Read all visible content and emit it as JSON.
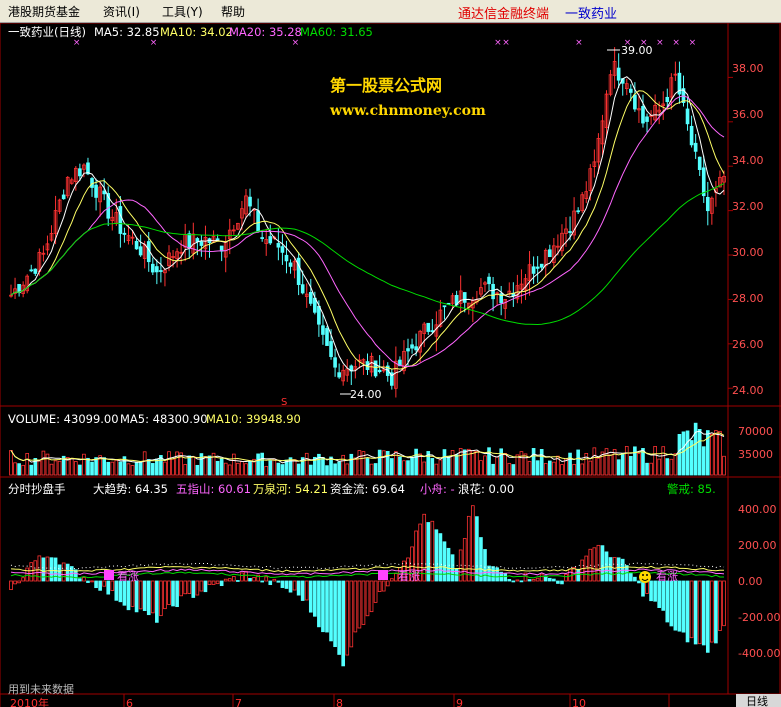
{
  "menu": {
    "items": [
      "港股期货基金",
      "资讯(I)",
      "工具(Y)",
      "帮助"
    ],
    "brand": "通达信金融终端",
    "stock_name": "一致药业"
  },
  "colors": {
    "background": "#000000",
    "frame": "#a00000",
    "up": "#ff3232",
    "down": "#54ffff",
    "ma5": "#ffffff",
    "ma10": "#ffff66",
    "ma20": "#ff66ff",
    "ma60": "#00dd00"
  },
  "watermark": {
    "line1": "第一股票公式网",
    "line2": "www.chnmoney.com"
  },
  "price_panel": {
    "title": "一致药业(日线)",
    "ma_labels": [
      "MA5: 32.85",
      "MA10: 34.02",
      "MA20: 35.28",
      "MA60: 31.65"
    ],
    "high_label": "39.00",
    "low_label": "24.00",
    "s_marker": "S",
    "axis_ticks": [
      "38.00",
      "36.00",
      "34.00",
      "32.00",
      "30.00",
      "28.00",
      "26.00",
      "24.00"
    ]
  },
  "volume_panel": {
    "labels": [
      "VOLUME: 43099.00",
      "MA5: 48300.90",
      "MA10: 39948.90"
    ],
    "axis_ticks": [
      "70000",
      "35000"
    ]
  },
  "indicator_panel": {
    "name": "分时抄盘手",
    "labels": [
      "大趋势: 64.35",
      "五指山: 60.61",
      "万泉河: 54.21",
      "资金流: 69.64",
      "小舟: -",
      "浪花: 0.00",
      "警戒: 85."
    ],
    "axis_ticks": [
      "400.00",
      "200.00",
      "0.00",
      "-200.00",
      "-400.00"
    ],
    "signals": [
      "看涨",
      "看涨",
      "看涨"
    ]
  },
  "bottom": {
    "note": "用到未来数据",
    "year": "2010年",
    "months": [
      "6",
      "7",
      "8",
      "9",
      "10"
    ],
    "period": "日线"
  },
  "chart_data": {
    "type": "candlestick",
    "title": "一致药业(日线)",
    "price_range": [
      23.2,
      40.0
    ],
    "annotated_high": 39.0,
    "annotated_low": 24.0,
    "price_anchors_close": [
      [
        0,
        28.2
      ],
      [
        8,
        30.0
      ],
      [
        14,
        33.5
      ],
      [
        18,
        34.0
      ],
      [
        24,
        32.0
      ],
      [
        28,
        31.0
      ],
      [
        32,
        30.3
      ],
      [
        36,
        29.2
      ],
      [
        42,
        30.5
      ],
      [
        48,
        30.7
      ],
      [
        52,
        30.5
      ],
      [
        58,
        32.5
      ],
      [
        62,
        30.8
      ],
      [
        66,
        30.4
      ],
      [
        70,
        29.5
      ],
      [
        76,
        26.5
      ],
      [
        80,
        24.9
      ],
      [
        86,
        25.1
      ],
      [
        90,
        25.0
      ],
      [
        94,
        24.5
      ],
      [
        98,
        25.6
      ],
      [
        104,
        27.0
      ],
      [
        110,
        28.0
      ],
      [
        116,
        28.5
      ],
      [
        122,
        28.2
      ],
      [
        128,
        29.3
      ],
      [
        134,
        30.5
      ],
      [
        140,
        32.0
      ],
      [
        144,
        34.0
      ],
      [
        148,
        38.5
      ],
      [
        152,
        38.0
      ],
      [
        156,
        36.0
      ],
      [
        160,
        36.5
      ],
      [
        164,
        38.0
      ],
      [
        168,
        35.0
      ],
      [
        172,
        32.0
      ],
      [
        176,
        33.5
      ]
    ],
    "volume_anchors": [
      [
        0,
        25000
      ],
      [
        30,
        24000
      ],
      [
        70,
        22000
      ],
      [
        100,
        28000
      ],
      [
        140,
        27000
      ],
      [
        160,
        30000
      ],
      [
        168,
        58000
      ],
      [
        176,
        43099
      ]
    ],
    "indicator_anchors": [
      [
        0,
        -60
      ],
      [
        5,
        100
      ],
      [
        10,
        150
      ],
      [
        15,
        60
      ],
      [
        22,
        -30
      ],
      [
        30,
        -150
      ],
      [
        36,
        -210
      ],
      [
        42,
        -100
      ],
      [
        50,
        -30
      ],
      [
        58,
        40
      ],
      [
        66,
        -20
      ],
      [
        72,
        -90
      ],
      [
        78,
        -300
      ],
      [
        82,
        -450
      ],
      [
        86,
        -250
      ],
      [
        90,
        -120
      ],
      [
        94,
        30
      ],
      [
        98,
        150
      ],
      [
        102,
        370
      ],
      [
        106,
        250
      ],
      [
        110,
        80
      ],
      [
        114,
        420
      ],
      [
        118,
        80
      ],
      [
        124,
        20
      ],
      [
        130,
        30
      ],
      [
        136,
        0
      ],
      [
        140,
        90
      ],
      [
        144,
        200
      ],
      [
        148,
        150
      ],
      [
        152,
        80
      ],
      [
        156,
        -60
      ],
      [
        160,
        -150
      ],
      [
        164,
        -280
      ],
      [
        168,
        -330
      ],
      [
        172,
        -380
      ],
      [
        176,
        -260
      ]
    ],
    "indicator_range": [
      -500,
      500
    ],
    "series": [
      {
        "name": "MA5",
        "period": 5
      },
      {
        "name": "MA10",
        "period": 10
      },
      {
        "name": "MA20",
        "period": 20
      },
      {
        "name": "MA60",
        "period": 60
      }
    ],
    "volume_range": [
      0,
      80000
    ],
    "x_months": [
      "6",
      "7",
      "8",
      "9",
      "10"
    ]
  }
}
